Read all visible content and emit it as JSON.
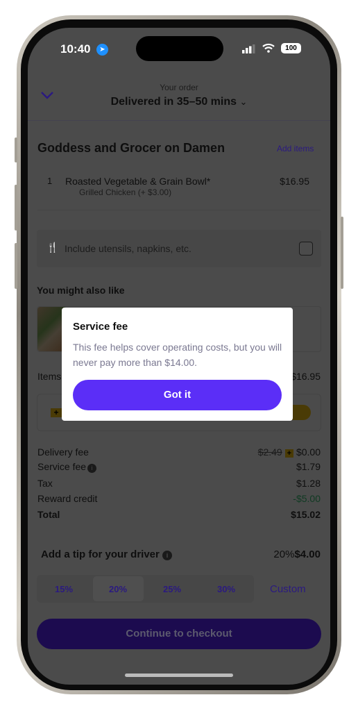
{
  "status_bar": {
    "time": "10:40",
    "battery": "100"
  },
  "header": {
    "subtitle": "Your order",
    "title": "Delivered in 35–50 mins"
  },
  "store": {
    "name": "Goddess and Grocer on Damen",
    "add_items": "Add items"
  },
  "cart_items": [
    {
      "qty": "1",
      "name": "Roasted Vegetable & Grain Bowl*",
      "option": "Grilled Chicken (+ $3.00)",
      "price": "$16.95"
    }
  ],
  "utensils": {
    "label": "Include utensils, napkins, etc.",
    "checked": false
  },
  "suggestions": {
    "title": "You might also like"
  },
  "subtotal": {
    "label": "Items",
    "value": "$16.95"
  },
  "fees": [
    {
      "label": "Delivery fee",
      "original": "$2.49",
      "value": "$0.00"
    },
    {
      "label": "Service fee",
      "value": "$1.79"
    },
    {
      "label": "Tax",
      "value": "$1.28"
    },
    {
      "label": "Reward credit",
      "value": "-$5.00"
    },
    {
      "label": "Total",
      "value": "$15.02"
    }
  ],
  "tip": {
    "title": "Add a tip for your driver",
    "percent": "20%",
    "amount": "$4.00",
    "options": [
      "15%",
      "20%",
      "25%",
      "30%"
    ],
    "selected": "20%",
    "custom": "Custom"
  },
  "checkout": {
    "label": "Continue to checkout"
  },
  "modal": {
    "title": "Service fee",
    "body": "This fee helps cover operating costs, but you will never pay more than $14.00.",
    "button": "Got it"
  },
  "colors": {
    "brand": "#5B2EF7",
    "credit": "#2e8b57",
    "plus_badge": "#f5c518"
  }
}
